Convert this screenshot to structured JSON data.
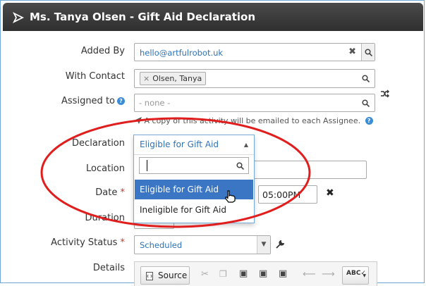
{
  "window": {
    "title": "Ms. Tanya Olsen - Gift Aid Declaration"
  },
  "form": {
    "added_by": {
      "label": "Added By",
      "value": "hello@artfulrobot.uk"
    },
    "with_contact": {
      "label": "With Contact",
      "tag": "Olsen, Tanya"
    },
    "assigned_to": {
      "label": "Assigned to",
      "placeholder": "- none -",
      "note": "A copy of this activity will be emailed to each Assignee."
    },
    "declaration": {
      "label": "Declaration",
      "selected": "Eligible for Gift Aid",
      "options": [
        "Eligible for Gift Aid",
        "Ineligible for Gift Aid"
      ]
    },
    "location": {
      "label": "Location"
    },
    "date": {
      "label": "Date",
      "required_mark": "*",
      "time": "05:00PM"
    },
    "duration": {
      "label": "Duration"
    },
    "activity_status": {
      "label": "Activity Status",
      "required_mark": "*",
      "value": "Scheduled"
    },
    "details": {
      "label": "Details",
      "source_label": "Source"
    }
  },
  "colors": {
    "annotation": "#e01e1e",
    "accent": "#2e73b8",
    "highlight": "#3a76c4"
  }
}
